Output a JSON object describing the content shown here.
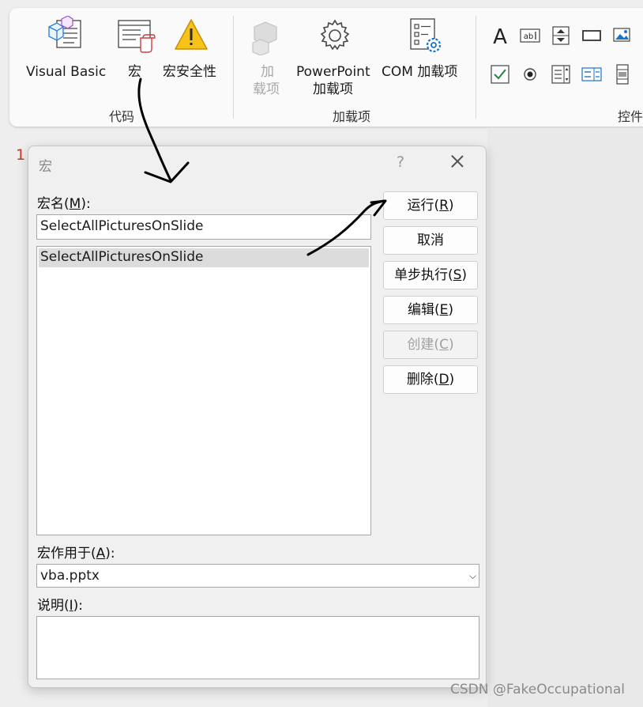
{
  "ribbon": {
    "code_group": {
      "label": "代码",
      "visual_basic": "Visual Basic",
      "macros": "宏",
      "macro_security": "宏安全性"
    },
    "addins_group": {
      "label": "加载项",
      "addins_line1": "加",
      "addins_line2": "载项",
      "powerpoint_addins_line1": "PowerPoint",
      "powerpoint_addins_line2": "加载项",
      "com_addins": "COM 加载项"
    },
    "controls_group": {
      "label": "控件"
    }
  },
  "slide": {
    "number": "1"
  },
  "dialog": {
    "title": "宏",
    "help": "?",
    "macro_name_label": "宏名",
    "macro_name_accel": "M",
    "macro_name_value": "SelectAllPicturesOnSlide",
    "macro_list": [
      "SelectAllPicturesOnSlide"
    ],
    "macros_in_label": "宏作用于",
    "macros_in_accel": "A",
    "macros_in_value": "vba.pptx",
    "description_label": "说明",
    "description_accel": "I",
    "description_value": "",
    "buttons": {
      "run": {
        "text": "运行",
        "accel": "R"
      },
      "cancel": {
        "text": "取消"
      },
      "step_into": {
        "text": "单步执行",
        "accel": "S"
      },
      "edit": {
        "text": "编辑",
        "accel": "E"
      },
      "create": {
        "text": "创建",
        "accel": "C"
      },
      "delete": {
        "text": "删除",
        "accel": "D"
      }
    }
  },
  "watermark": "CSDN @FakeOccupational",
  "colors": {
    "slide_number": "#c43e1c",
    "warning_icon": "#f0b400",
    "gear_blue": "#1a73c8",
    "check_green": "#1e8a3c"
  }
}
